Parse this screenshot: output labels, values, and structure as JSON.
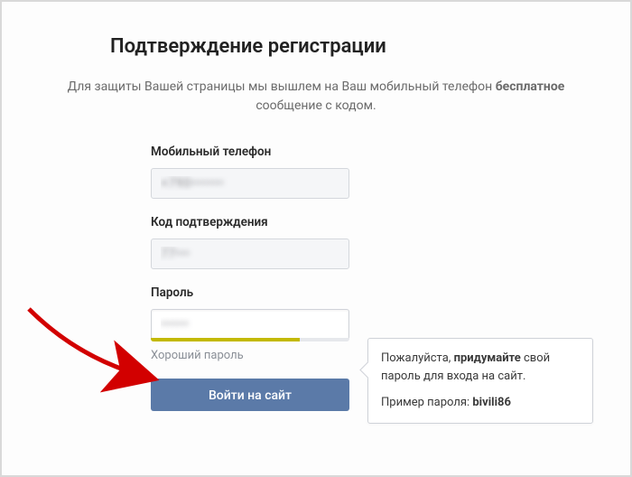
{
  "title": "Подтверждение регистрации",
  "subtitle_pre": "Для защиты Вашей страницы мы вышлем на Ваш мобильный телефон ",
  "subtitle_strong": "бесплатное",
  "subtitle_post": " сообщение с кодом.",
  "phone": {
    "label": "Мобильный телефон",
    "value": "+790•••••••"
  },
  "code": {
    "label": "Код подтверждения",
    "value": "77•••"
  },
  "password": {
    "label": "Пароль",
    "value": "••••••",
    "strength_label": "Хороший пароль"
  },
  "tooltip": {
    "line1_pre": "Пожалуйста, ",
    "line1_strong": "придумайте",
    "line1_post": " свой пароль для входа на сайт.",
    "example_label": "Пример пароля: ",
    "example_value": "bivili86"
  },
  "submit_label": "Войти на сайт"
}
